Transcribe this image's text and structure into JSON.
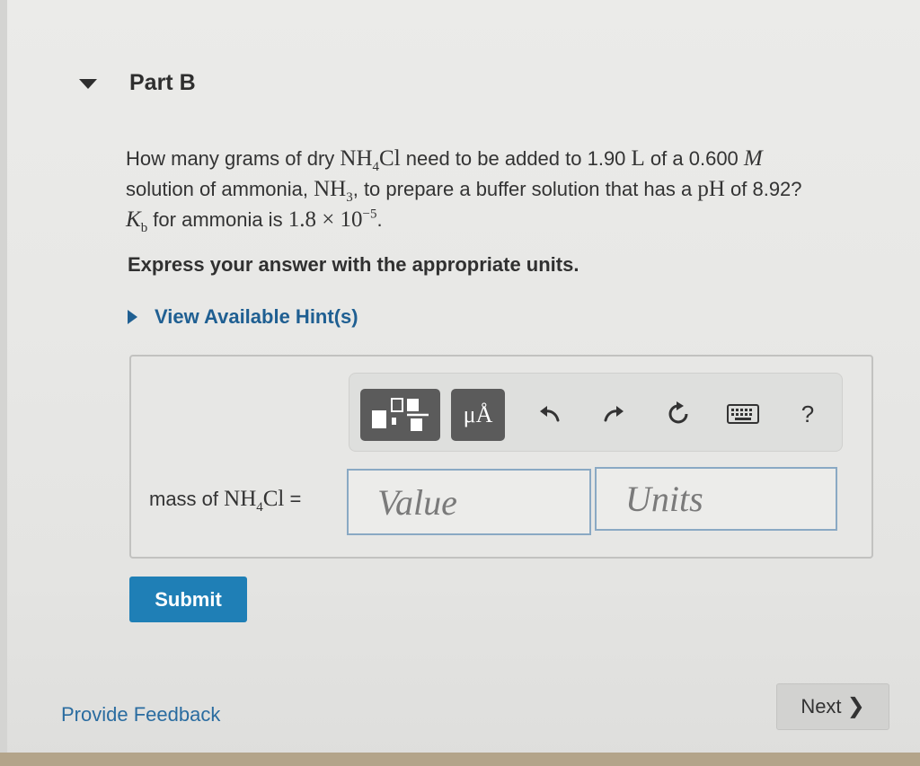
{
  "part": {
    "title": "Part B"
  },
  "question": {
    "t1": "How many grams of dry ",
    "nh4cl_a": "NH",
    "nh4cl_sub": "4",
    "nh4cl_b": "Cl",
    "t2": " need to be added to 1.90 ",
    "unit_L": "L",
    "t3": " of a 0.600 ",
    "unit_M": "M",
    "t4": "solution of ammonia, ",
    "nh3_a": "NH",
    "nh3_sub": "3",
    "t5": ", to prepare a buffer solution that has a ",
    "ph": "pH",
    "t6": " of 8.92?",
    "kb_k": "K",
    "kb_sub": "b",
    "t7": " for ammonia is ",
    "kb_val": "1.8 × 10",
    "kb_exp": "−5",
    "t8": "."
  },
  "instruction": "Express your answer with the appropriate units.",
  "hint": {
    "label": "View Available Hint(s)"
  },
  "toolbar": {
    "units_label": "μÅ",
    "help_label": "?"
  },
  "answer": {
    "label_a": "mass of ",
    "label_nh": "NH",
    "label_sub": "4",
    "label_cl": "Cl",
    "label_eq": " =",
    "value_placeholder": "Value",
    "units_placeholder": "Units"
  },
  "submit_label": "Submit",
  "feedback_label": "Provide Feedback",
  "next_label": "Next",
  "colors": {
    "link": "#1f5f92",
    "submit_bg": "#1f7fb6",
    "dark_button": "#5b5b5b"
  }
}
